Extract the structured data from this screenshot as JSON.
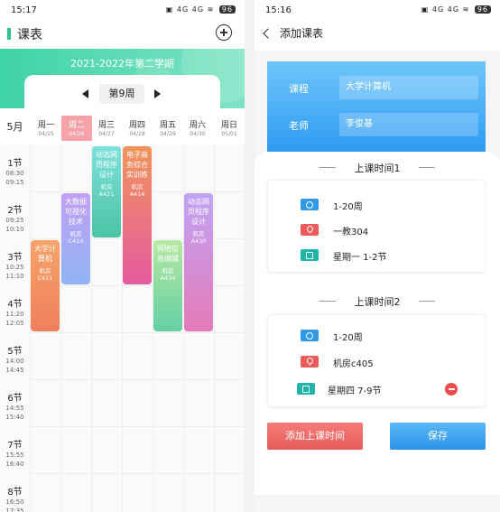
{
  "left": {
    "status": {
      "time": "15:17",
      "icons": "▣ 4G 4G ≋ ",
      "battery": "96"
    },
    "header": {
      "title": "课表"
    },
    "term": "2021-2022年第二学期",
    "week": "第9周",
    "month": "5月",
    "days": [
      {
        "name": "周一",
        "date": "04/25"
      },
      {
        "name": "周二",
        "date": "04/26"
      },
      {
        "name": "周三",
        "date": "04/27"
      },
      {
        "name": "周四",
        "date": "04/28"
      },
      {
        "name": "周五",
        "date": "04/29"
      },
      {
        "name": "周六",
        "date": "04/30"
      },
      {
        "name": "周日",
        "date": "05/01"
      }
    ],
    "periods": [
      {
        "n": "1节",
        "s": "08:30",
        "e": "09:15"
      },
      {
        "n": "2节",
        "s": "09:25",
        "e": "10:10"
      },
      {
        "n": "3节",
        "s": "10:25",
        "e": "11:10"
      },
      {
        "n": "4节",
        "s": "11:20",
        "e": "12:05"
      },
      {
        "n": "5节",
        "s": "14:00",
        "e": "14:45"
      },
      {
        "n": "6节",
        "s": "14:55",
        "e": "15:40"
      },
      {
        "n": "7节",
        "s": "15:55",
        "e": "16:40"
      },
      {
        "n": "8节",
        "s": "16:50",
        "e": "17:35"
      }
    ],
    "courses": [
      {
        "name": "大学计算机",
        "room": "机房C411",
        "day": 1,
        "start": 3,
        "span": 2,
        "color1": "#f7a36a",
        "color2": "#ef7f5c"
      },
      {
        "name": "大数据可视化技术",
        "room": "机房C414",
        "day": 2,
        "start": 2,
        "span": 2,
        "color1": "#c2a0f5",
        "color2": "#8fb4f5"
      },
      {
        "name": "动态网页程序设计",
        "room": "机房A421",
        "day": 3,
        "start": 1,
        "span": 2,
        "color1": "#7fe0dc",
        "color2": "#4cc4a5"
      },
      {
        "name": "电子商务综合实训练",
        "room": "机房A414",
        "day": 4,
        "start": 1,
        "span": 3,
        "color1": "#f1945a",
        "color2": "#e55aa0"
      },
      {
        "name": "网络信息编辑",
        "room": "机房A434",
        "day": 5,
        "start": 3,
        "span": 2,
        "color1": "#b6e9a2",
        "color2": "#65cfa4"
      },
      {
        "name": "动态网页程序设计",
        "room": "机房A430",
        "day": 6,
        "start": 2,
        "span": 3,
        "color1": "#c1a3f5",
        "color2": "#e47bb8"
      }
    ]
  },
  "right": {
    "status": {
      "time": "15:16",
      "icons": "▣ 4G 4G ≋ ",
      "battery": "96"
    },
    "header": {
      "title": "添加课表"
    },
    "course_label": "课程",
    "course_value": "大学计算机",
    "teacher_label": "老师",
    "teacher_value": "李俊基",
    "slot1": {
      "title": "上课时间1",
      "weeks": "1-20周",
      "room": "一教304",
      "time": "星期一 1-2节"
    },
    "slot2": {
      "title": "上课时间2",
      "weeks": "1-20周",
      "room": "机房c405",
      "time": "星期四 7-9节"
    },
    "add_button": "添加上课时间",
    "save_button": "保存",
    "colors": {
      "accent_blue": "#2d9bf2",
      "accent_red": "#e55d5b",
      "accent_green": "#2cc48f"
    }
  }
}
